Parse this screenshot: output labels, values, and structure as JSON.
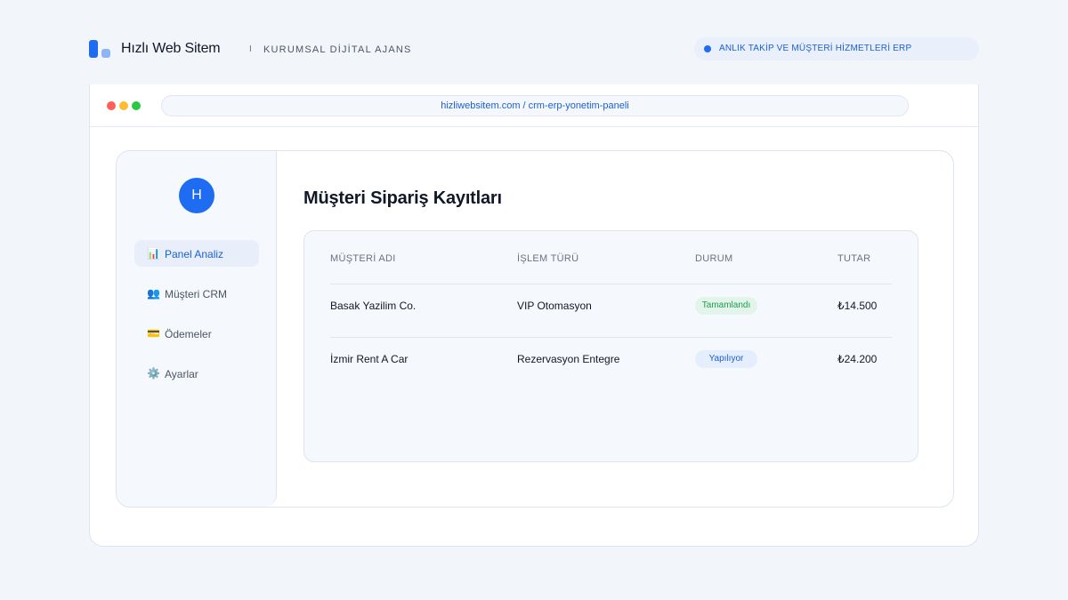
{
  "brand": {
    "name": "Hızlı Web Sitem",
    "separator": "I",
    "tagline": "KURUMSAL DİJİTAL AJANS"
  },
  "status_pill": {
    "text": "ANLIK TAKİP VE MÜŞTERİ HİZMETLERİ ERP",
    "dot_color": "#1d6cf2"
  },
  "browser": {
    "url": "hizliwebsitem.com / crm-erp-yonetim-paneli"
  },
  "sidebar": {
    "avatar_initial": "H",
    "items": [
      {
        "icon": "📊",
        "icon_name": "bar-chart-icon",
        "label": "Panel Analiz",
        "active": true
      },
      {
        "icon": "👥",
        "icon_name": "users-icon",
        "label": "Müşteri CRM",
        "active": false
      },
      {
        "icon": "💳",
        "icon_name": "credit-card-icon",
        "label": "Ödemeler",
        "active": false
      },
      {
        "icon": "⚙️",
        "icon_name": "gear-icon",
        "label": "Ayarlar",
        "active": false
      }
    ]
  },
  "main": {
    "title": "Müşteri Sipariş Kayıtları",
    "table": {
      "headers": [
        "MÜŞTERİ ADI",
        "İŞLEM TÜRÜ",
        "DURUM",
        "TUTAR"
      ],
      "rows": [
        {
          "customer": "Basak Yazilim Co.",
          "type": "VIP Otomasyon",
          "status": "Tamamlandı",
          "status_kind": "done",
          "amount": "₺14.500"
        },
        {
          "customer": "İzmir Rent A Car",
          "type": "Rezervasyon Entegre",
          "status": "Yapılıyor",
          "status_kind": "progress",
          "amount": "₺24.200"
        }
      ]
    }
  },
  "colors": {
    "accent": "#1d6cf2",
    "success": "#1b9e4b",
    "background": "#f2f6fb"
  }
}
